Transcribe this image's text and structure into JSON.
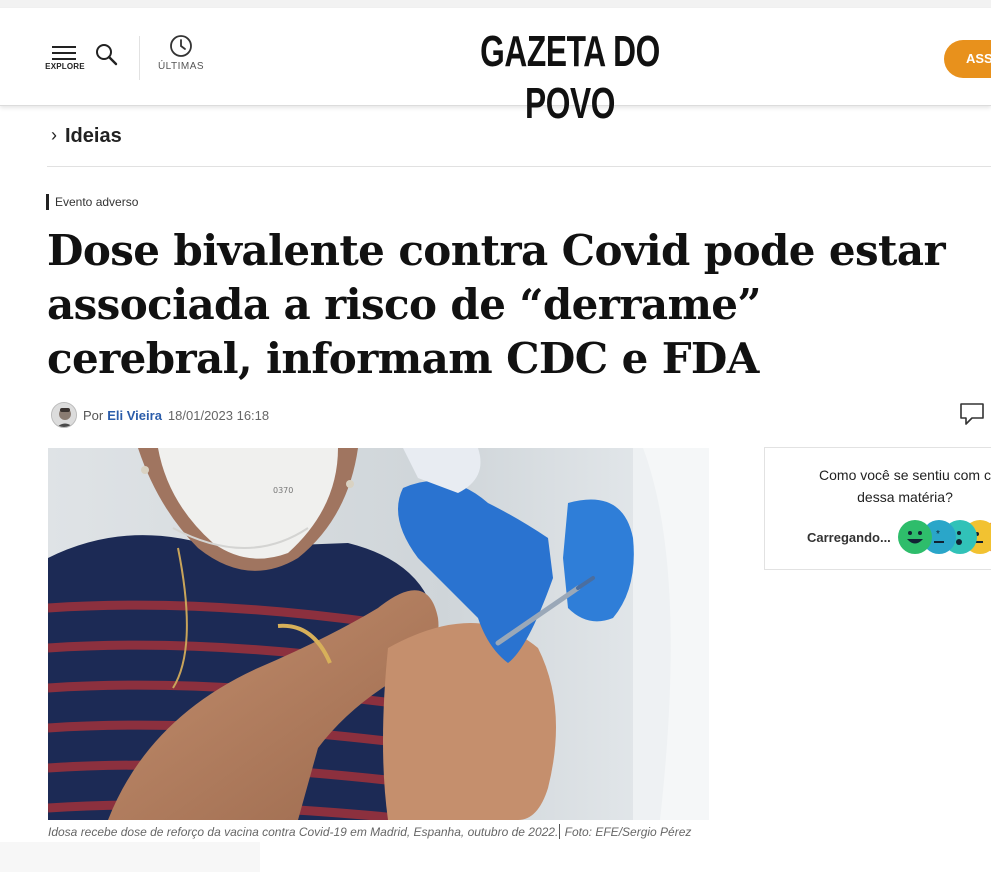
{
  "header": {
    "explore_label": "EXPLORE",
    "ultimas_label": "ÚLTIMAS",
    "logo_text": "GAZETA DO POVO",
    "subscribe_label": "ASS",
    "subscribe_color": "#e8911c"
  },
  "section": {
    "name": "Ideias"
  },
  "article": {
    "tag": "Evento adverso",
    "headline": "Dose bivalente contra Covid pode estar associada a risco de “derrame” cerebral, informam CDC e FDA",
    "byline_prefix": "Por",
    "author": "Eli Vieira",
    "datetime": "18/01/2023 16:18",
    "author_color": "#2a5caa"
  },
  "photo": {
    "caption": "Idosa recebe dose de reforço da vacina contra Covid-19 em Madrid, Espanha, outubro de 2022.",
    "credit": "Foto: EFE/Sergio Pérez"
  },
  "feelings_widget": {
    "question": "Como você se sentiu com o conteúdo dessa matéria?",
    "question_visible": "Como você se sentiu com c dessa matéria?",
    "loading_label": "Carregando...",
    "emojis": [
      {
        "name": "happy-face-icon",
        "color": "#2ebd6b"
      },
      {
        "name": "starstruck-face-icon",
        "color": "#2aa6c9"
      },
      {
        "name": "surprised-face-icon",
        "color": "#31c2b8"
      },
      {
        "name": "neutral-face-icon",
        "color": "#f2c231"
      },
      {
        "name": "sad-face-icon",
        "color": "#f08a3e"
      }
    ]
  }
}
